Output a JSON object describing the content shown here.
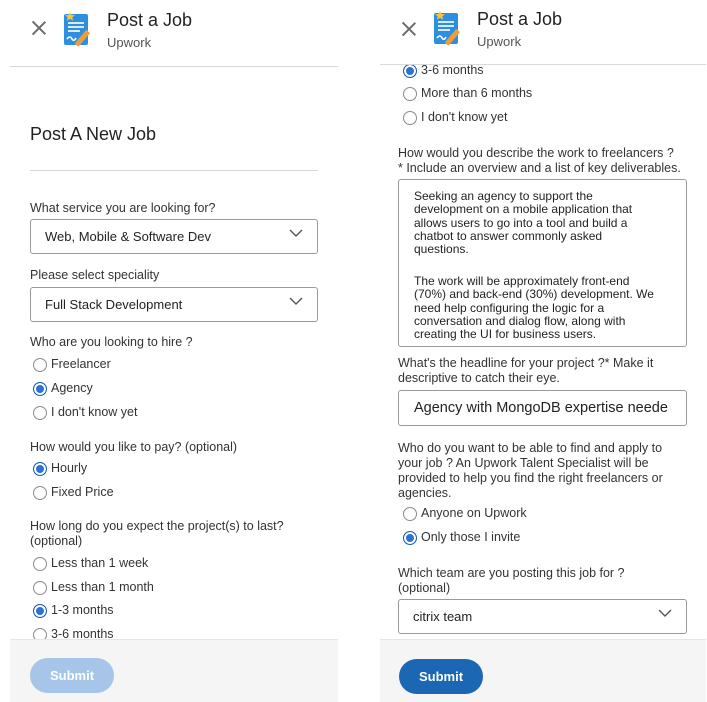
{
  "header": {
    "title": "Post a Job",
    "subtitle": "Upwork"
  },
  "left": {
    "page_title": "Post A New Job",
    "service": {
      "label": "What service you are looking for?",
      "value": "Web, Mobile & Software Dev"
    },
    "speciality": {
      "label": "Please select speciality",
      "value": "Full Stack Development"
    },
    "hire": {
      "label": "Who are you looking to hire ?",
      "options": [
        "Freelancer",
        "Agency",
        "I don't know yet"
      ],
      "selected": "Agency"
    },
    "pay": {
      "label": "How would you like to pay? (optional)",
      "options": [
        "Hourly",
        "Fixed Price"
      ],
      "selected": "Hourly"
    },
    "duration": {
      "label_line1": "How long do you expect the project(s) to last?",
      "label_line2": "(optional)",
      "options": [
        "Less than 1 week",
        "Less than 1 month",
        "1-3 months",
        "3-6 months"
      ],
      "selected": "1-3 months"
    },
    "submit_label": "Submit"
  },
  "right": {
    "duration_options": [
      "3-6 months",
      "More than 6 months",
      "I don't know yet"
    ],
    "duration_selected": "3-6 months",
    "describe": {
      "label_line1": "How would you describe the work to freelancers ?",
      "label_line2": "* Include an overview and a list of key deliverables.",
      "para1": [
        "Seeking an agency to support the",
        "development on a mobile application that",
        "allows users to go into a tool and build a",
        "chatbot to answer commonly asked",
        "questions."
      ],
      "para2": [
        "The work will be approximately front-end",
        "(70%) and back-end (30%) development. We",
        "need help configuring the logic for a",
        "conversation and dialog flow, along with",
        "creating the UI for business users."
      ]
    },
    "headline": {
      "label_line1": "What's the headline for your project ?* Make it",
      "label_line2": "descriptive to catch their eye.",
      "value": "Agency with MongoDB expertise neede"
    },
    "visibility": {
      "label_lines": [
        "Who do you want to be able to find and apply to",
        "your job ? An Upwork Talent Specialist will be",
        "provided to help you find the right freelancers or",
        "agencies."
      ],
      "options": [
        "Anyone on Upwork",
        "Only those I invite"
      ],
      "selected": "Only those I invite"
    },
    "team": {
      "label_line1": "Which team are you posting this job for ?",
      "label_line2": "(optional)",
      "value": "citrix team"
    },
    "submit_label": "Submit"
  },
  "colors": {
    "primary": "#1b67b3",
    "radio_selected": "#2a72d3",
    "submit_disabled": "#a6c5e8",
    "footer_bg": "#f5f5f5"
  }
}
